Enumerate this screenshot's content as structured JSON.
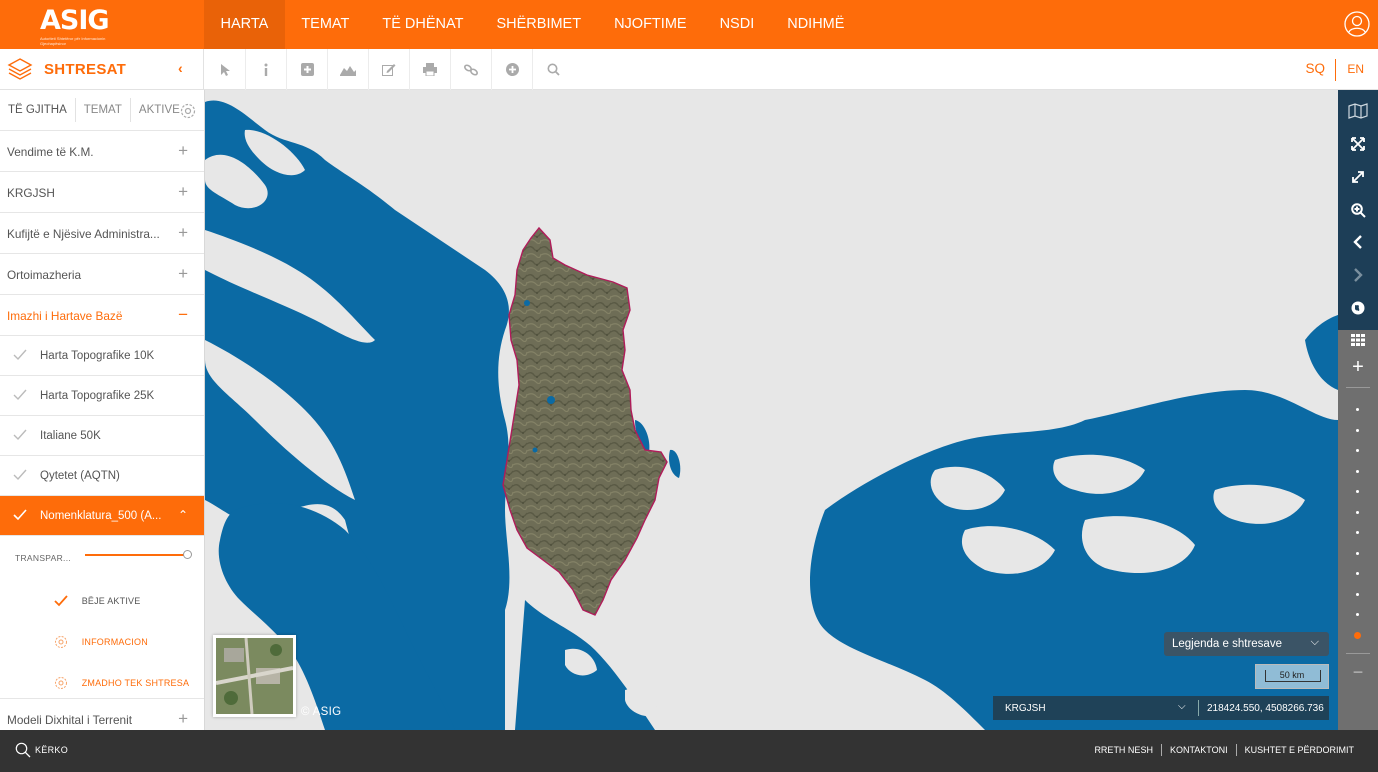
{
  "header": {
    "logo_text": "ASIG",
    "logo_tagline": "Autoriteti Shtetëror për Informacionin Gjeohapësinor",
    "nav": [
      {
        "label": "HARTA"
      },
      {
        "label": "TEMAT"
      },
      {
        "label": "TË DHËNAT"
      },
      {
        "label": "SHËRBIMET"
      },
      {
        "label": "NJOFTIME"
      },
      {
        "label": "NSDI"
      },
      {
        "label": "NDIHMË"
      }
    ],
    "active_nav": "HARTA"
  },
  "toolbar": {
    "layers_title": "SHTRESAT",
    "tools": [
      "pointer-icon",
      "info-icon",
      "add-icon",
      "profile-icon",
      "edit-icon",
      "print-icon",
      "link-icon",
      "add-circle-icon",
      "search-icon"
    ],
    "lang_sq": "SQ",
    "lang_en": "EN"
  },
  "sidebar": {
    "tabs": [
      "TË GJITHA",
      "TEMAT",
      "AKTIVE"
    ],
    "groups": [
      {
        "label": "Vendime të K.M.",
        "toggle": "+"
      },
      {
        "label": "KRGJSH",
        "toggle": "+"
      },
      {
        "label": "Kufijtë e Njësive Administra...",
        "toggle": "+"
      },
      {
        "label": "Ortoimazheria",
        "toggle": "+"
      }
    ],
    "open_group": {
      "label": "Imazhi i Hartave Bazë",
      "toggle": "−"
    },
    "layers": [
      {
        "label": "Harta Topografike 10K"
      },
      {
        "label": "Harta Topografike 25K"
      },
      {
        "label": "Italiane 50K"
      },
      {
        "label": "Qytetet (AQTN)"
      }
    ],
    "selected_layer": {
      "label": "Nomenklatura_500 (A..."
    },
    "transparency_label": "TRANSPAR...",
    "transparency_value": 1.0,
    "options": {
      "activate": "BËJE AKTIVE",
      "info": "INFORMACION",
      "zoom": "ZMADHO TEK SHTRESA"
    },
    "last_group": {
      "label": "Modeli Dixhital i Terrenit",
      "toggle": "+"
    }
  },
  "map": {
    "copyright": "© ASIG",
    "legend_button": "Legjenda e shtresave",
    "scale_label": "50 km",
    "coord_layer": "KRGJSH",
    "coords": "218424.550, 4508266.736",
    "colors": {
      "sea": "#0b6aa4",
      "land": "#e8e8e8",
      "boundary": "#b01c5a"
    }
  },
  "rightbar": {
    "icons": [
      "map-icon",
      "fullscreen-icon",
      "expand-icon",
      "zoom-box-icon",
      "back-icon",
      "forward-icon",
      "globe-icon",
      "grid-icon"
    ],
    "zoom_in": "+",
    "zoom_out": "−",
    "zoom_level": 12
  },
  "footer": {
    "search_label": "KËRKO",
    "links": [
      "RRETH NESH",
      "KONTAKTONI",
      "KUSHTET E PËRDORIMIT"
    ]
  },
  "theme": {
    "accent": "#fe6c0a",
    "footer_bg": "#333333",
    "panel_dark": "#1d3e57"
  }
}
